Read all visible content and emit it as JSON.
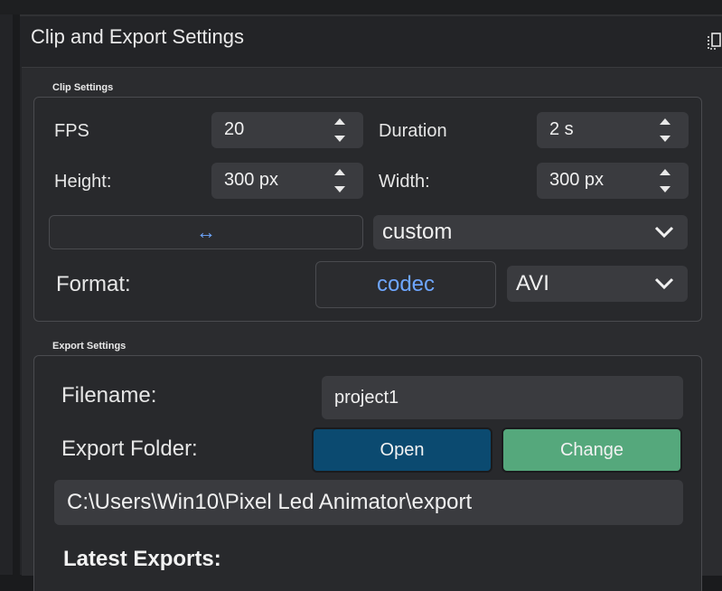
{
  "window": {
    "title": "Clip and Export Settings"
  },
  "clip_settings": {
    "section_label": "Clip Settings",
    "fps": {
      "label": "FPS",
      "value": "20"
    },
    "duration": {
      "label": "Duration",
      "value": "2 s"
    },
    "height": {
      "label": "Height:",
      "value": "300 px"
    },
    "width": {
      "label": "Width:",
      "value": "300 px"
    },
    "swap_button": "↔",
    "preset": "custom",
    "format": {
      "label": "Format:",
      "codec_button": "codec",
      "value": "AVI"
    }
  },
  "export_settings": {
    "section_label": "Export Settings",
    "filename": {
      "label": "Filename:",
      "value": "project1"
    },
    "export_folder": {
      "label": "Export Folder:",
      "open_button": "Open",
      "change_button": "Change"
    },
    "path": "C:\\Users\\Win10\\Pixel Led Animator\\export",
    "latest_exports_label": "Latest Exports:"
  },
  "colors": {
    "background": "#232427",
    "field": "#3a3b3f",
    "open_button": "#0b4a70",
    "change_button": "#55a87c",
    "link_text": "#6ea6ff"
  }
}
